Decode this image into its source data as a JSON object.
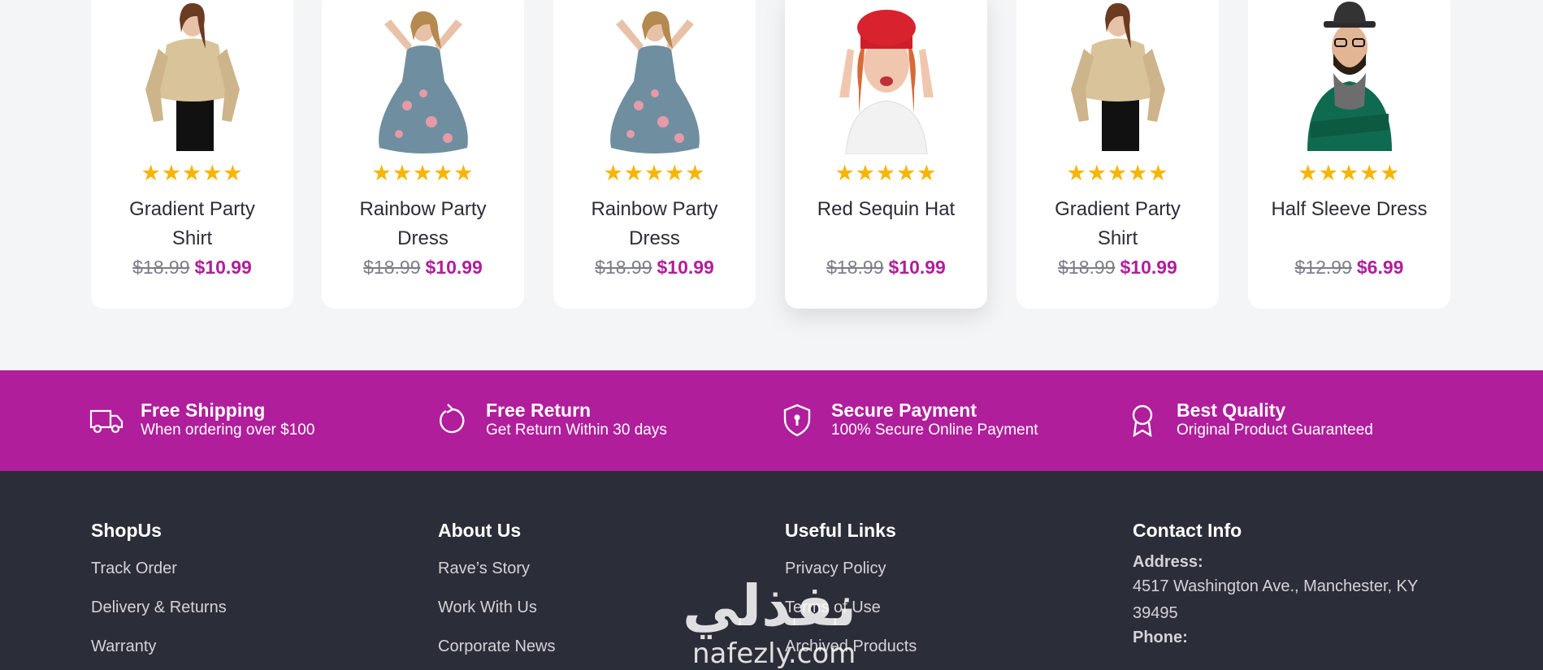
{
  "products": [
    {
      "name": "Gradient Party Shirt",
      "old_price": "$18.99",
      "new_price": "$10.99",
      "rating_stars": "★★★★★",
      "rating": 5,
      "image": "woman-satin-shirt-photo"
    },
    {
      "name": "Rainbow Party Dress",
      "old_price": "$18.99",
      "new_price": "$10.99",
      "rating_stars": "★★★★★",
      "rating": 5,
      "image": "floral-dress-photo"
    },
    {
      "name": "Rainbow Party Dress",
      "old_price": "$18.99",
      "new_price": "$10.99",
      "rating_stars": "★★★★★",
      "rating": 5,
      "image": "floral-dress-photo"
    },
    {
      "name": "Red Sequin Hat",
      "old_price": "$18.99",
      "new_price": "$10.99",
      "rating_stars": "★★★★★",
      "rating": 5,
      "image": "woman-red-beret-photo"
    },
    {
      "name": "Gradient Party Shirt",
      "old_price": "$18.99",
      "new_price": "$10.99",
      "rating_stars": "★★★★★",
      "rating": 5,
      "image": "woman-satin-shirt-photo"
    },
    {
      "name": "Half Sleeve Dress",
      "old_price": "$12.99",
      "new_price": "$6.99",
      "rating_stars": "★★★★★",
      "rating": 5,
      "image": "man-green-sweater-photo"
    }
  ],
  "features": [
    {
      "icon": "truck-icon",
      "title": "Free Shipping",
      "subtitle": "When ordering over $100"
    },
    {
      "icon": "return-icon",
      "title": "Free Return",
      "subtitle": "Get Return Within 30 days"
    },
    {
      "icon": "shield-lock-icon",
      "title": "Secure Payment",
      "subtitle": "100% Secure Online Payment"
    },
    {
      "icon": "award-badge-icon",
      "title": "Best Quality",
      "subtitle": "Original Product Guaranteed"
    }
  ],
  "footer": {
    "shopus": {
      "title": "ShopUs",
      "links": [
        "Track Order",
        "Delivery & Returns",
        "Warranty"
      ]
    },
    "about": {
      "title": "About Us",
      "links": [
        "Rave’s Story",
        "Work With Us",
        "Corporate News"
      ]
    },
    "useful": {
      "title": "Useful Links",
      "links": [
        "Privacy Policy",
        "Terms of Use",
        "Archived Products"
      ]
    },
    "contact": {
      "title": "Contact Info",
      "address_label": "Address:",
      "address": "4517 Washington Ave., Manchester, KY 39495",
      "phone_label": "Phone:"
    }
  },
  "watermark": {
    "arabic": "نفذلي",
    "latin": "nafezly.com"
  },
  "colors": {
    "accent": "#b01e9b",
    "star": "#f7b500",
    "footer_bg": "#2b2d38",
    "page_bg": "#f4f5f7"
  }
}
